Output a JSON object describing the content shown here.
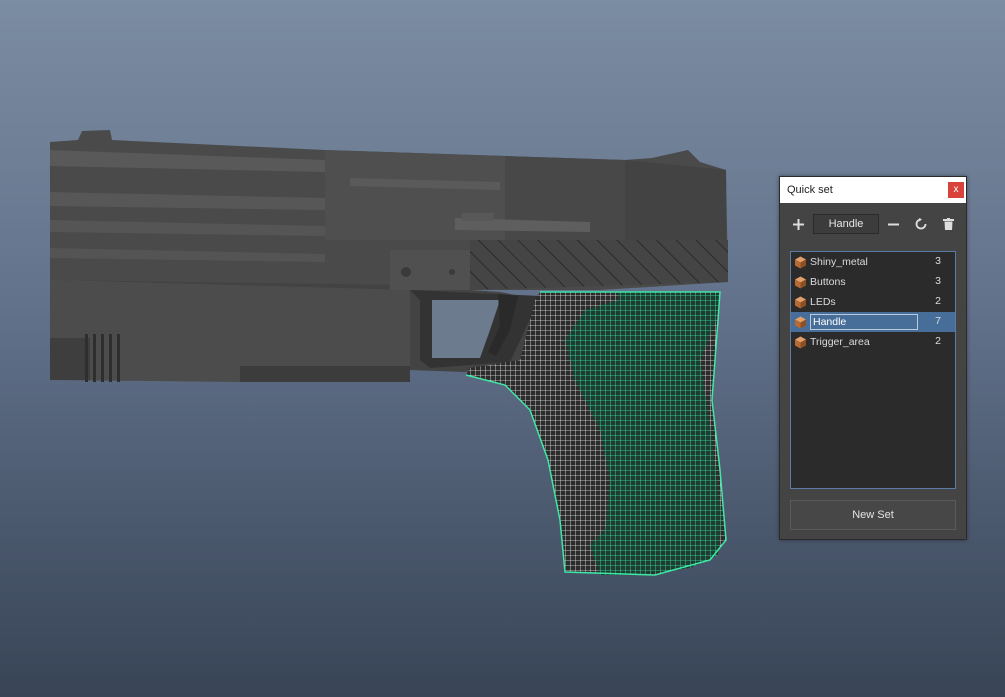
{
  "panel": {
    "title": "Quick set",
    "close_label": "x",
    "current_name": "Handle",
    "icons": {
      "add": "plus-icon",
      "remove": "minus-icon",
      "refresh": "refresh-icon",
      "delete": "trash-icon",
      "set": "cube-icon"
    },
    "sets": [
      {
        "name": "Shiny_metal",
        "count": "3"
      },
      {
        "name": "Buttons",
        "count": "3"
      },
      {
        "name": "LEDs",
        "count": "2"
      },
      {
        "name": "Handle",
        "count": "7"
      },
      {
        "name": "Trigger_area",
        "count": "2"
      }
    ],
    "selected_index": 3,
    "new_set_label": "New Set"
  },
  "colors": {
    "selection": "#476e98",
    "wireframe_highlight": "#3ee8a6",
    "close_button": "#d9413b"
  }
}
